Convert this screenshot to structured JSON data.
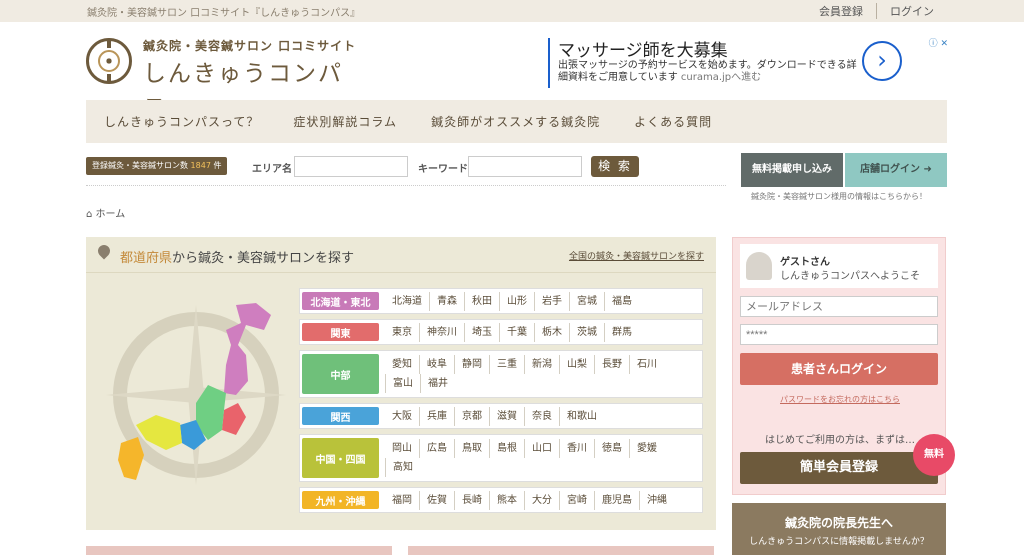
{
  "topbar": {
    "tagline": "鍼灸院・美容鍼サロン 口コミサイト『しんきゅうコンパス』",
    "member_register": "会員登録",
    "login": "ログイン"
  },
  "logo": {
    "sub": "鍼灸院・美容鍼サロン 口コミサイト",
    "main": "しんきゅうコンパス"
  },
  "ad": {
    "headline": "マッサージ師を大募集",
    "desc": "出張マッサージの予約サービスを始めます。ダウンロードできる詳細資料をご用意しています",
    "url": "curama.jpへ進む",
    "arrow": "›",
    "badge": "ⓘ ✕"
  },
  "nav": [
    "しんきゅうコンパスって？",
    "症状別解説コラム",
    "鍼灸師がオススメする鍼灸院",
    "よくある質問"
  ],
  "search": {
    "count_label": "登録鍼灸・美容鍼サロン数",
    "count": "1847",
    "count_unit": "件",
    "area_label": "エリア名",
    "keyword_label": "キーワード",
    "button": "検 索"
  },
  "shop": {
    "apply": "無料掲載申し込み",
    "login": "店舗ログイン ➜",
    "note": "鍼灸院・美容鍼サロン様用の情報はこちらから！"
  },
  "breadcrumb": {
    "home": "ホーム"
  },
  "area": {
    "title_hl": "都道府県",
    "title_rest": "から鍼灸・美容鍼サロンを探す",
    "all_link": "全国の鍼灸・美容鍼サロンを探す",
    "regions": [
      {
        "name": "北海道・東北",
        "color": "#c87ab8",
        "prefs": [
          "北海道",
          "青森",
          "秋田",
          "山形",
          "岩手",
          "宮城",
          "福島"
        ]
      },
      {
        "name": "関東",
        "color": "#e26c6c",
        "prefs": [
          "東京",
          "神奈川",
          "埼玉",
          "千葉",
          "栃木",
          "茨城",
          "群馬"
        ]
      },
      {
        "name": "中部",
        "color": "#6fc07a",
        "prefs": [
          "愛知",
          "岐阜",
          "静岡",
          "三重",
          "新潟",
          "山梨",
          "長野",
          "石川",
          "富山",
          "福井"
        ]
      },
      {
        "name": "関西",
        "color": "#4aa3d9",
        "prefs": [
          "大阪",
          "兵庫",
          "京都",
          "滋賀",
          "奈良",
          "和歌山"
        ]
      },
      {
        "name": "中国・四国",
        "color": "#b9c23a",
        "prefs": [
          "岡山",
          "広島",
          "鳥取",
          "島根",
          "山口",
          "香川",
          "徳島",
          "愛媛",
          "高知"
        ]
      },
      {
        "name": "九州・沖縄",
        "color": "#f2b526",
        "prefs": [
          "福岡",
          "佐賀",
          "長崎",
          "熊本",
          "大分",
          "宮崎",
          "鹿児島",
          "沖縄"
        ]
      }
    ]
  },
  "sidebar": {
    "guest_name": "ゲストさん",
    "welcome": "しんきゅうコンパスへようこそ",
    "email_placeholder": "メールアドレス",
    "password_value": "*****",
    "patient_login": "患者さんログイン",
    "forgot": "パスワードをお忘れの方はこちら",
    "first_time": "はじめてご利用の方は、まずは…",
    "signup": "簡単会員登録",
    "free_badge": "無料",
    "director_title": "鍼灸院の院長先生へ",
    "director_sub": "しんきゅうコンパスに情報掲載しませんか？"
  }
}
